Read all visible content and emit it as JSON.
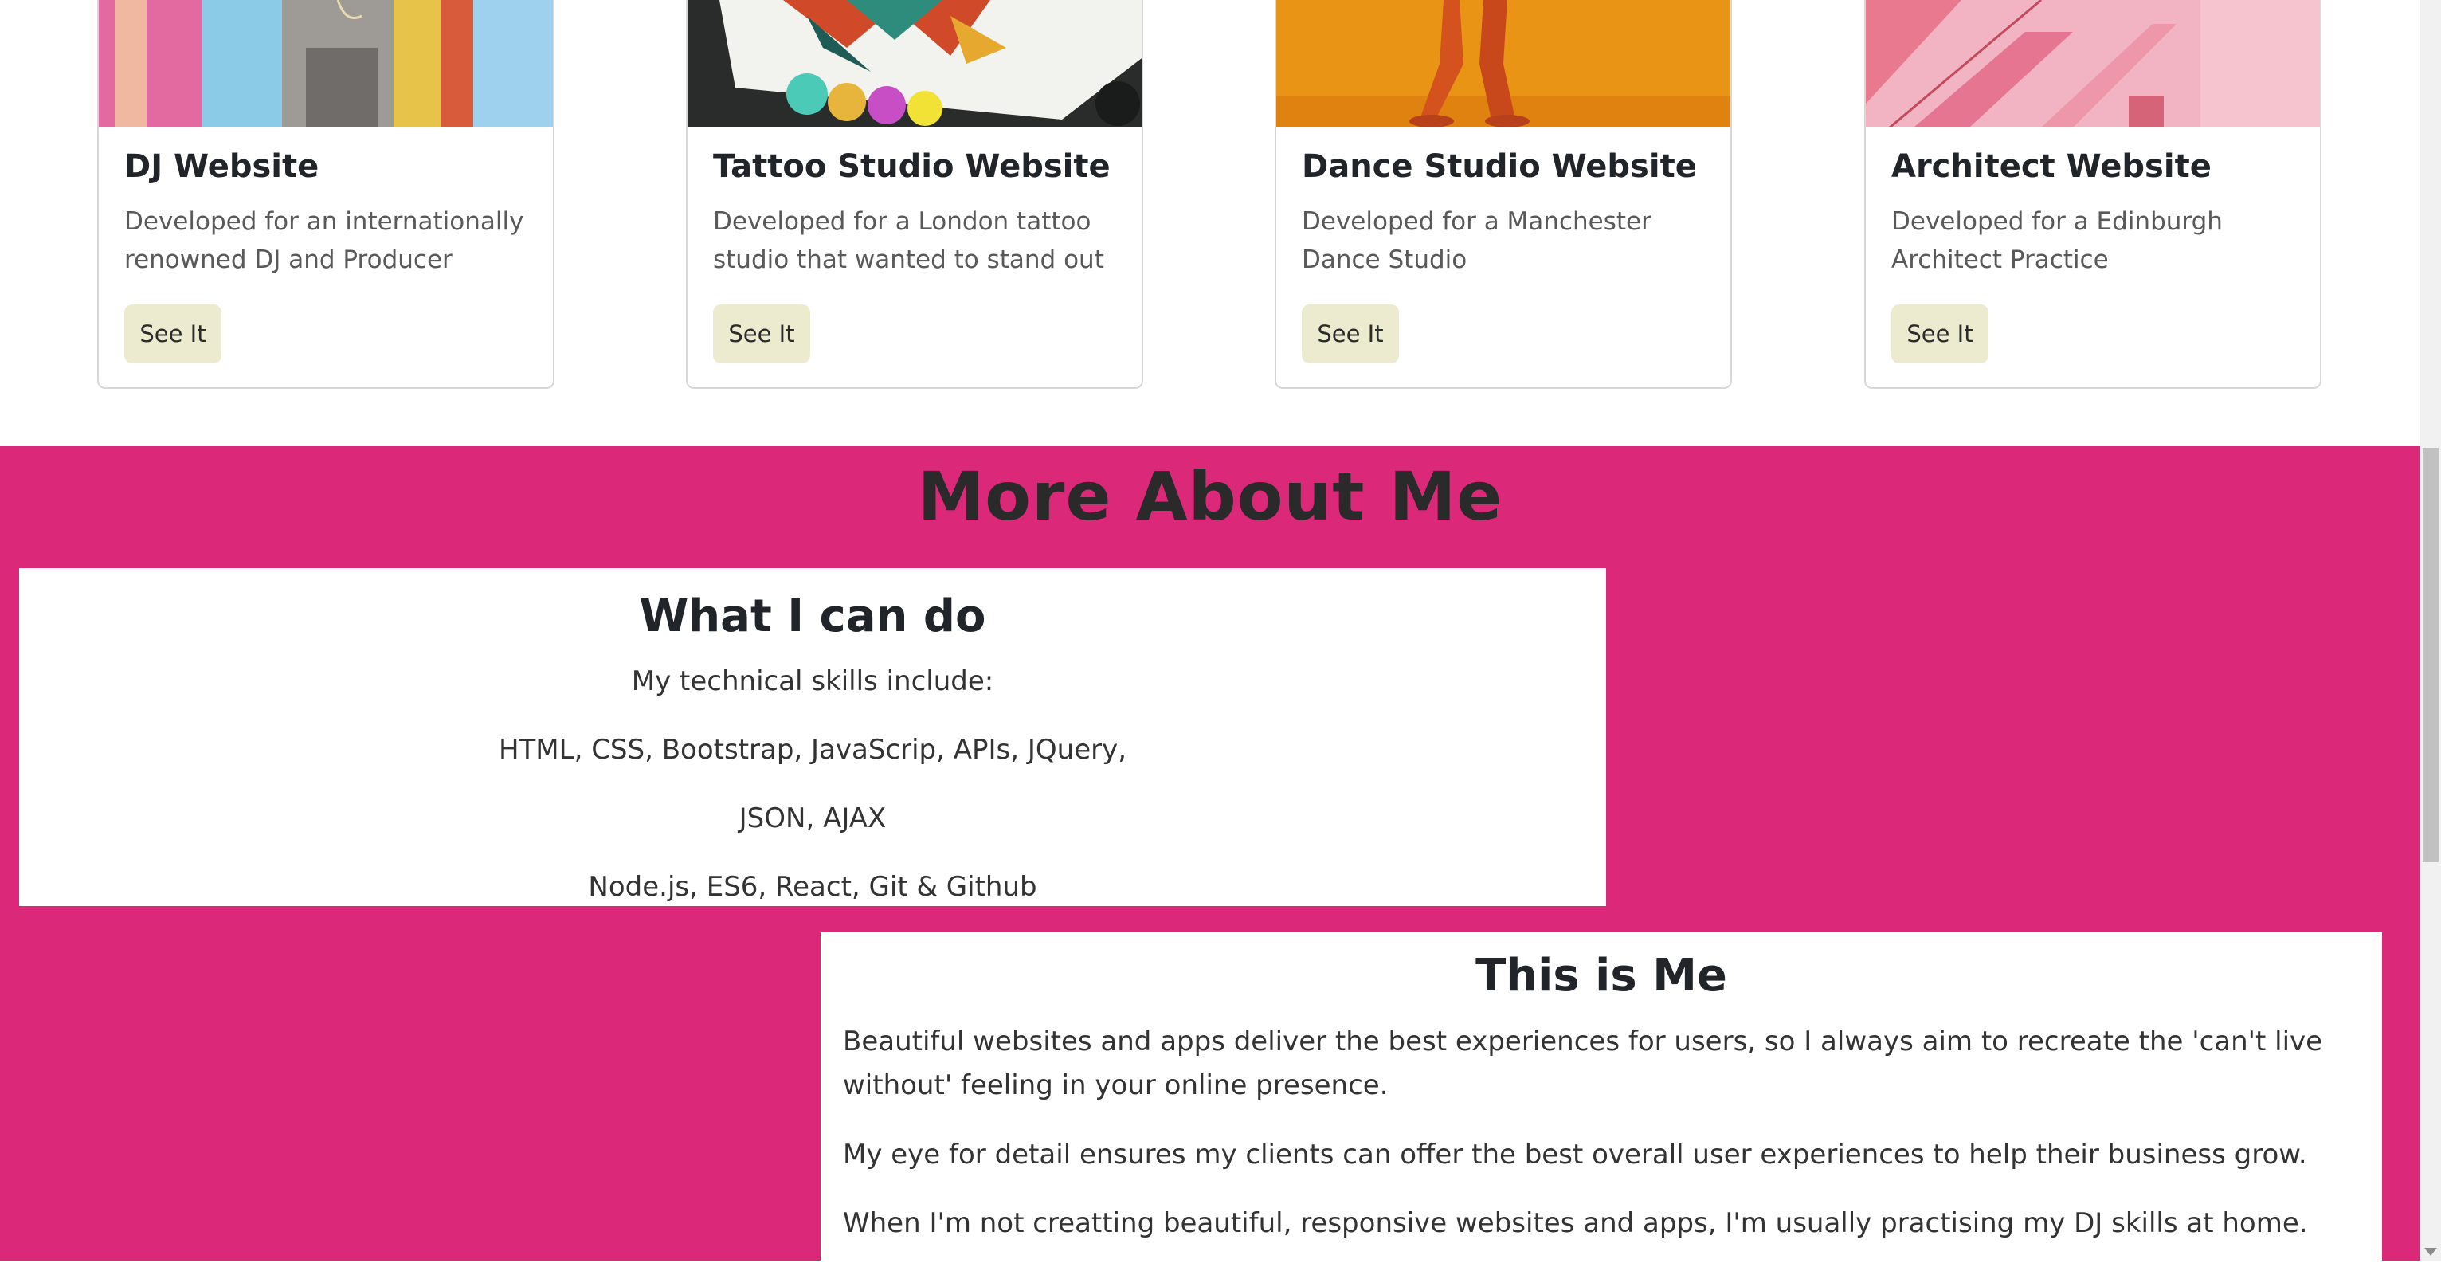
{
  "projects": [
    {
      "title": "DJ Website",
      "description": "Developed for an internationally renowned DJ and Producer",
      "button_label": "See It"
    },
    {
      "title": "Tattoo Studio Website",
      "description": "Developed for a London tattoo studio that wanted to stand out",
      "button_label": "See It"
    },
    {
      "title": "Dance Studio Website",
      "description": "Developed for a Manchester Dance Studio",
      "button_label": "See It"
    },
    {
      "title": "Architect Website",
      "description": "Developed for a Edinburgh Architect Practice",
      "button_label": "See It"
    }
  ],
  "about": {
    "heading": "More About Me",
    "skills": {
      "title": "What I can do",
      "lines": [
        "My technical skills include:",
        "HTML, CSS, Bootstrap, JavaScrip, APIs, JQuery,",
        "JSON, AJAX",
        "Node.js, ES6, React, Git & Github"
      ]
    },
    "me": {
      "title": "This is Me",
      "paragraphs": [
        "Beautiful websites and apps deliver the best experiences for users, so I always aim to recreate the 'can't live without' feeling in your online presence.",
        "My eye for detail ensures my clients can offer the best overall user experiences to help their business grow.",
        "When I'm not creatting beautiful, responsive websites and apps, I'm usually practising my DJ skills at home."
      ]
    }
  },
  "colors": {
    "about_background": "#dc2878",
    "button_background": "#ecebd0"
  }
}
